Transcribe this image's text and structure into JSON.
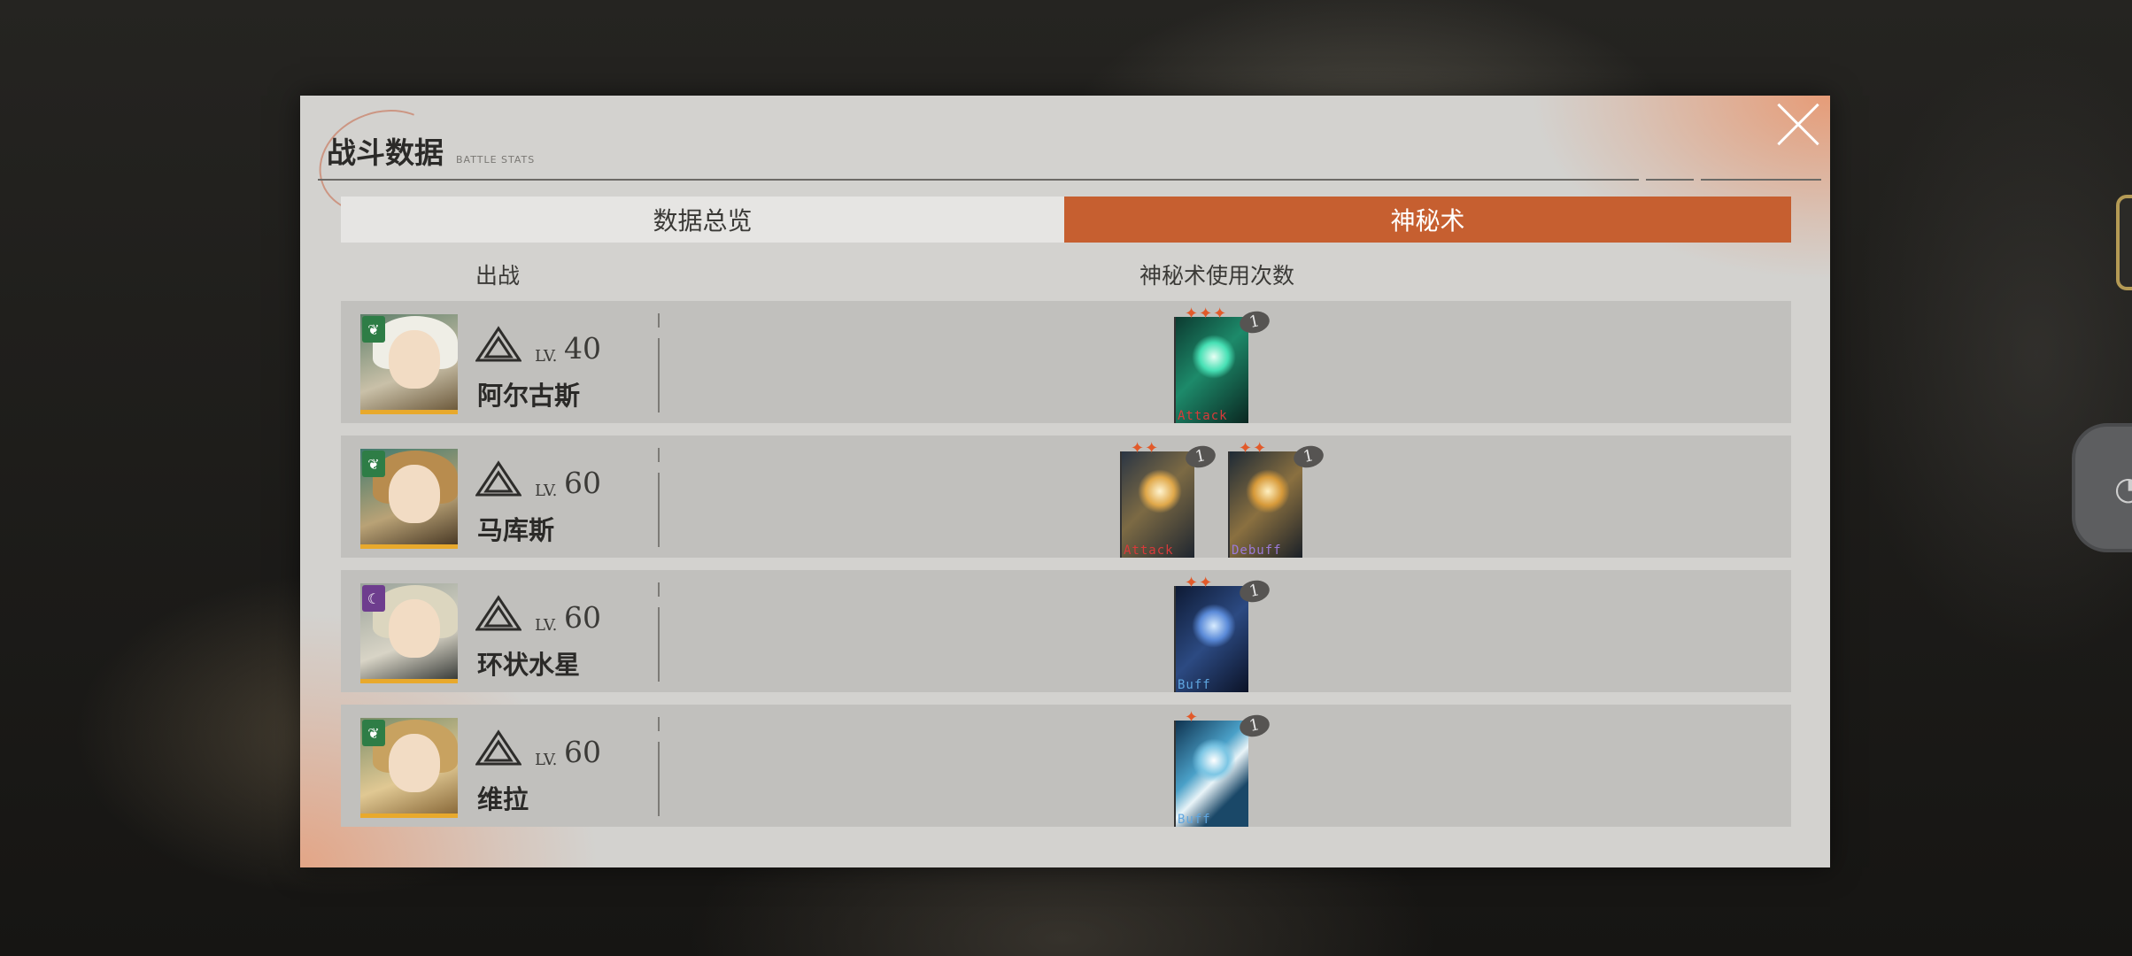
{
  "panel": {
    "title": "战斗数据",
    "subtitle": "BATTLE STATS"
  },
  "tabs": [
    {
      "label": "数据总览",
      "active": false
    },
    {
      "label": "神秘术",
      "active": true
    }
  ],
  "columns": {
    "deploy": "出战",
    "usage": "神秘术使用次数"
  },
  "colors": {
    "accent": "#c65f30",
    "panel": "#d3d2cf",
    "row": "#c1c0bd"
  },
  "rows": [
    {
      "name": "阿尔古斯",
      "lv_label": "LV.",
      "level": "40",
      "afflatus": "plant",
      "cards": [
        {
          "stars": "✦✦✦",
          "count": "1",
          "tag": "Attack",
          "theme": "green"
        }
      ]
    },
    {
      "name": "马库斯",
      "lv_label": "LV.",
      "level": "60",
      "afflatus": "plant",
      "cards": [
        {
          "stars": "✦✦",
          "count": "1",
          "tag": "Attack",
          "theme": "gold"
        },
        {
          "stars": "✦✦",
          "count": "1",
          "tag": "Debuff",
          "theme": "gold"
        }
      ]
    },
    {
      "name": "环状水星",
      "lv_label": "LV.",
      "level": "60",
      "afflatus": "star",
      "cards": [
        {
          "stars": "✦✦",
          "count": "1",
          "tag": "Buff",
          "theme": "night"
        }
      ]
    },
    {
      "name": "维拉",
      "lv_label": "LV.",
      "level": "60",
      "afflatus": "plant",
      "cards": [
        {
          "stars": "✦",
          "count": "1",
          "tag": "Buff",
          "theme": "wave"
        }
      ]
    }
  ]
}
